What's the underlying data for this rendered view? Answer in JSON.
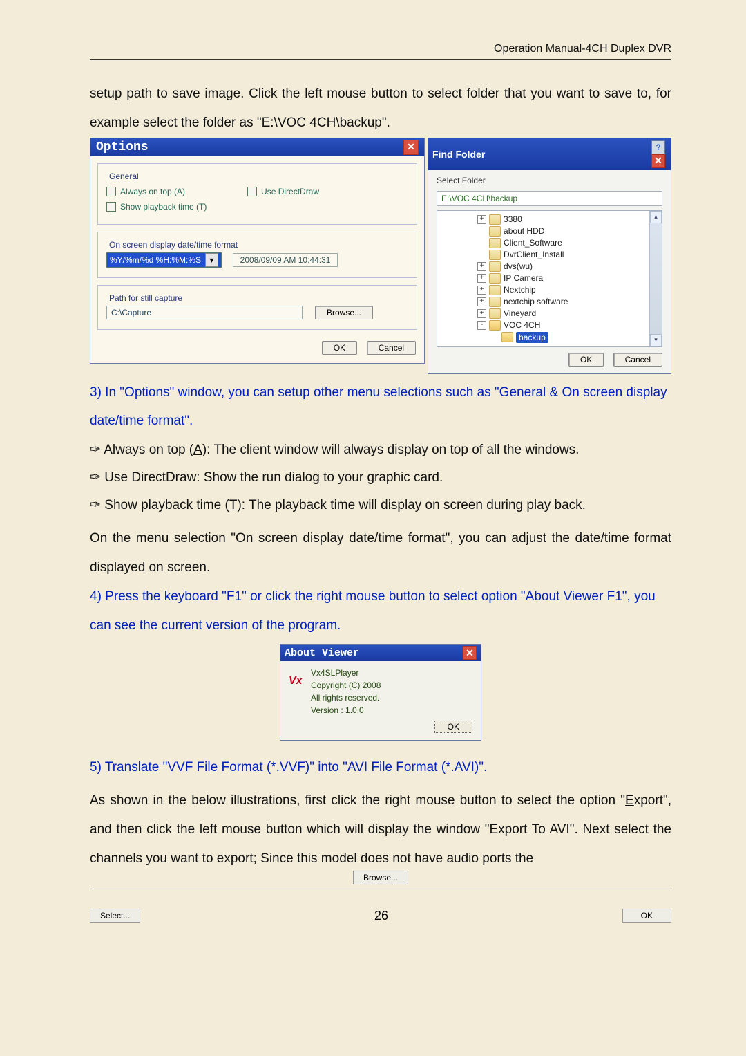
{
  "header": {
    "title": "Operation Manual-4CH Duplex DVR"
  },
  "intro_para": "setup path to save image. Click the left mouse button to select folder that you want to save to, for example select the folder as \"E:\\VOC 4CH\\backup\".",
  "options_dialog": {
    "title": "Options",
    "general_legend": "General",
    "always_on_top": "Always on top (A)",
    "use_directdraw": "Use DirectDraw",
    "show_playback_time": "Show playback time (T)",
    "osd_legend": "On screen display date/time format",
    "format_value": "%Y/%m/%d %H:%M:%S",
    "sample_time": "2008/09/09 AM 10:44:31",
    "path_legend": "Path for still capture",
    "path_value": "C:\\Capture",
    "browse": "Browse...",
    "ok": "OK",
    "cancel": "Cancel"
  },
  "find_folder": {
    "title": "Find Folder",
    "subtitle": "Select Folder",
    "path": "E:\\VOC 4CH\\backup",
    "items": [
      {
        "indent": 2,
        "exp": "+",
        "label": "3380"
      },
      {
        "indent": 2,
        "exp": "",
        "label": "about  HDD"
      },
      {
        "indent": 2,
        "exp": "",
        "label": "Client_Software"
      },
      {
        "indent": 2,
        "exp": "",
        "label": "DvrClient_Install"
      },
      {
        "indent": 2,
        "exp": "+",
        "label": "dvs(wu)"
      },
      {
        "indent": 2,
        "exp": "+",
        "label": "IP Camera"
      },
      {
        "indent": 2,
        "exp": "+",
        "label": "Nextchip"
      },
      {
        "indent": 2,
        "exp": "+",
        "label": "nextchip software"
      },
      {
        "indent": 2,
        "exp": "+",
        "label": "Vineyard"
      },
      {
        "indent": 2,
        "exp": "-",
        "label": "VOC 4CH"
      },
      {
        "indent": 3,
        "exp": "",
        "label": "backup",
        "selected": true
      }
    ],
    "ok": "OK",
    "cancel": "Cancel"
  },
  "note3": "3) In \"Options\" window, you can setup other menu selections such as \"General & On screen display date/time format\".",
  "bullet1_pre": "Always on top (",
  "bullet1_key": "A",
  "bullet1_post": "): The client window will always display on top of all the windows.",
  "bullet2": "Use DirectDraw: Show the run dialog to your graphic card.",
  "bullet3_pre": "Show playback time (",
  "bullet3_key": "T",
  "bullet3_post": "): The playback time will display on screen during play back.",
  "osd_para": "On the menu selection \"On screen display date/time format\", you can adjust the date/time format displayed on screen.",
  "note4": "4) Press the keyboard \"F1\" or click the right mouse button to select option \"About Viewer F1\", you can see the current version of the program.",
  "about": {
    "title": "About Viewer",
    "line1": "Vx4SLPlayer",
    "line2": "Copyright (C) 2008",
    "line3": "All rights reserved.",
    "line4": "Version :    1.0.0",
    "ok": "OK"
  },
  "note5": "5) Translate \"VVF File Format (*.VVF)\" into \"AVI File Format (*.AVI)\".",
  "export_para_1": "As shown in the below illustrations, first click the right mouse button to select the option \"",
  "export_key": "E",
  "export_para_2": "xport\", and then click the left mouse button which will display the window \"Export To AVI\". Next select the channels you want to export; Since this model does not have audio ports the",
  "stray": {
    "browse": "Browse...",
    "select": "Select...",
    "ok": "OK"
  },
  "page_number": "26"
}
